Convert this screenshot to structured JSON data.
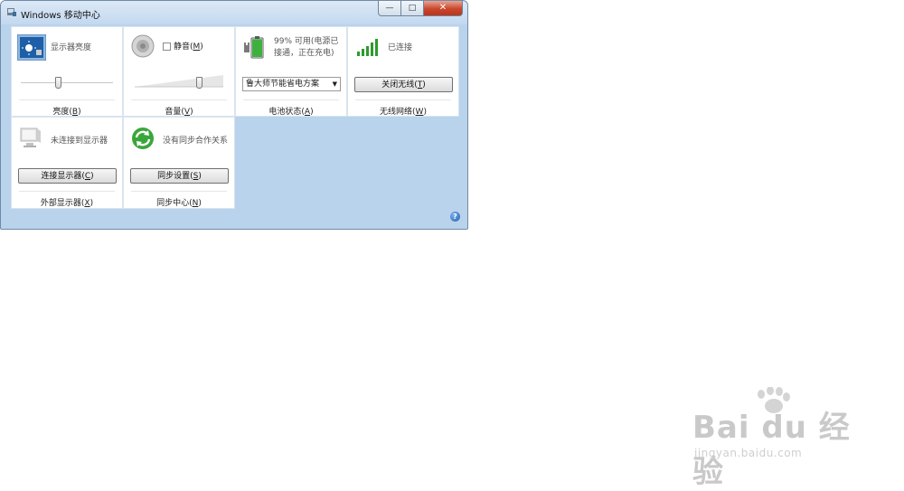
{
  "window": {
    "title": "Windows 移动中心",
    "minimize_glyph": "—",
    "maximize_glyph": "□",
    "close_glyph": "✕",
    "help_glyph": "?"
  },
  "tiles": {
    "brightness": {
      "status": "显示器亮度",
      "caption_text": "亮度(",
      "caption_key": "B",
      "caption_end": ")",
      "slider_value": 0.4
    },
    "volume": {
      "checkbox_label_text": "静音(",
      "checkbox_key": "M",
      "checkbox_label_end": ")",
      "muted": false,
      "caption_text": "音量(",
      "caption_key": "V",
      "caption_end": ")",
      "slider_value": 0.72
    },
    "battery": {
      "status_line1": "99% 可用(电源已",
      "status_line2": "接通，正在充电)",
      "plan_selected": "鲁大师节能省电方案",
      "caption_text": "电池状态(",
      "caption_key": "A",
      "caption_end": ")",
      "charge": 0.99
    },
    "wireless": {
      "status": "已连接",
      "button_text": "关闭无线(",
      "button_key": "T",
      "button_end": ")",
      "caption_text": "无线网络(",
      "caption_key": "W",
      "caption_end": ")"
    },
    "external_display": {
      "status": "未连接到显示器",
      "button_text": "连接显示器(",
      "button_key": "C",
      "button_end": ")",
      "caption_text": "外部显示器(",
      "caption_key": "X",
      "caption_end": ")"
    },
    "sync": {
      "status": "没有同步合作关系",
      "button_text": "同步设置(",
      "button_key": "S",
      "button_end": ")",
      "caption_text": "同步中心(",
      "caption_key": "N",
      "caption_end": ")"
    }
  },
  "watermark": {
    "main": "Bai du 经验",
    "sub": "jingyan.baidu.com"
  },
  "colors": {
    "window_bg": "#b9d3ec",
    "tile_bg": "#ffffff",
    "signal_green": "#2e9a2e",
    "close_red": "#c9472c"
  }
}
